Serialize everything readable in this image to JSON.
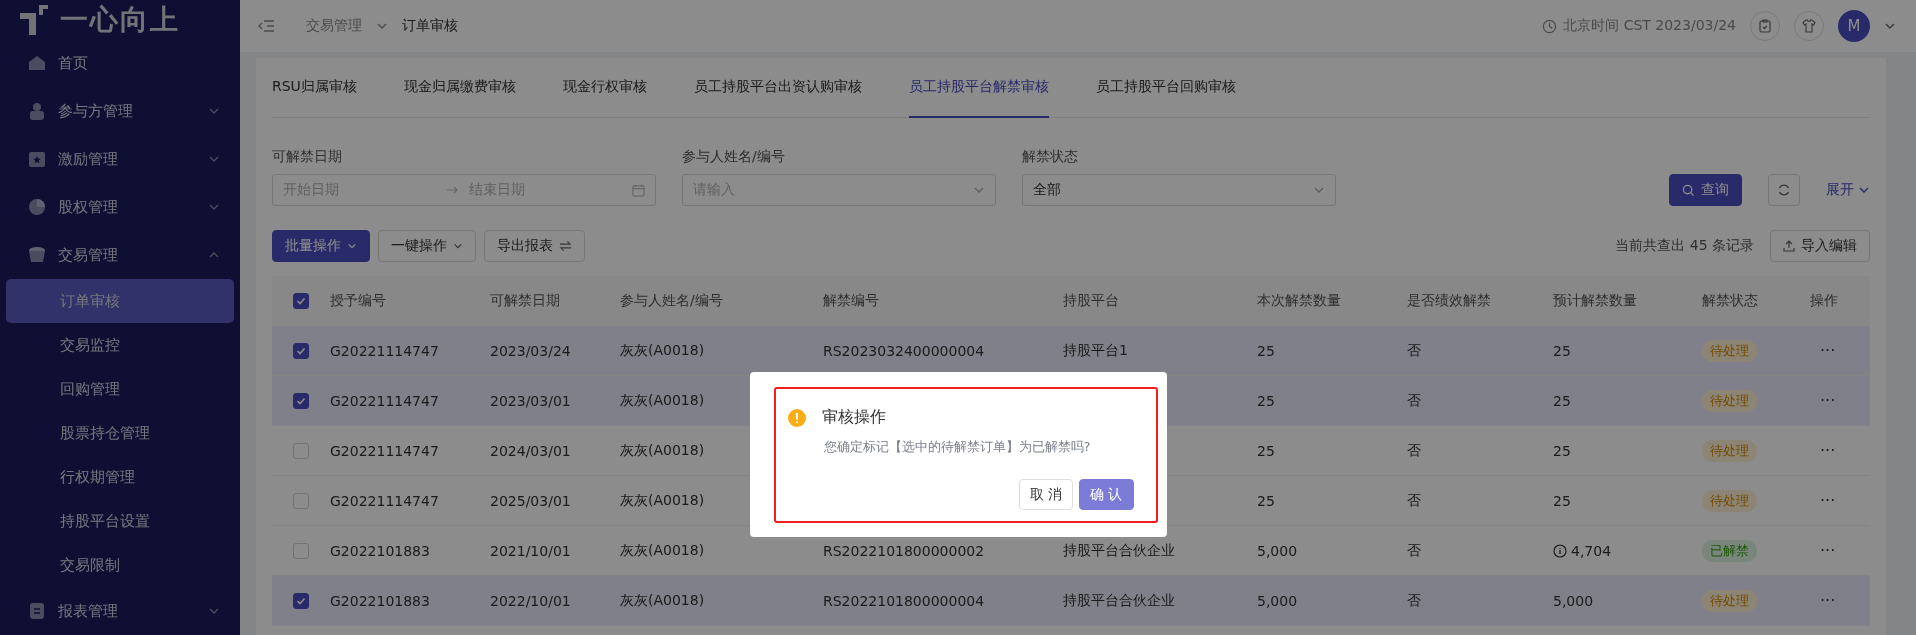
{
  "sidebar": {
    "logo": "一心向上",
    "items": [
      {
        "label": "首页",
        "kind": "link"
      },
      {
        "label": "参与方管理",
        "kind": "group",
        "expanded": false
      },
      {
        "label": "激励管理",
        "kind": "group",
        "expanded": false
      },
      {
        "label": "股权管理",
        "kind": "group",
        "expanded": false
      },
      {
        "label": "交易管理",
        "kind": "group",
        "expanded": true,
        "children": [
          {
            "label": "订单审核",
            "selected": true
          },
          {
            "label": "交易监控",
            "selected": false
          },
          {
            "label": "回购管理",
            "selected": false
          },
          {
            "label": "股票持仓管理",
            "selected": false
          },
          {
            "label": "行权期管理",
            "selected": false
          },
          {
            "label": "持股平台设置",
            "selected": false
          },
          {
            "label": "交易限制",
            "selected": false
          }
        ]
      },
      {
        "label": "报表管理",
        "kind": "group",
        "expanded": false
      }
    ]
  },
  "header": {
    "breadcrumb": [
      "交易管理",
      "订单审核"
    ],
    "time": "北京时间 CST 2023/03/24",
    "avatar": "M"
  },
  "tabs": [
    {
      "label": "RSU归属审核",
      "selected": false
    },
    {
      "label": "现金归属缴费审核",
      "selected": false
    },
    {
      "label": "现金行权审核",
      "selected": false
    },
    {
      "label": "员工持股平台出资认购审核",
      "selected": false
    },
    {
      "label": "员工持股平台解禁审核",
      "selected": true
    },
    {
      "label": "员工持股平台回购审核",
      "selected": false
    }
  ],
  "filters": [
    {
      "kind": "daterange",
      "label": "可解禁日期",
      "start_placeholder": "开始日期",
      "end_placeholder": "结束日期"
    },
    {
      "kind": "select",
      "label": "参与人姓名/编号",
      "placeholder": "请输入"
    },
    {
      "kind": "select",
      "label": "解禁状态",
      "value": "全部"
    }
  ],
  "filter_actions": {
    "search": "查询",
    "expand": "展开"
  },
  "toolbar": {
    "buttons": [
      {
        "label": "批量操作",
        "kind": "primary-dropdown"
      },
      {
        "label": "一键操作",
        "kind": "dropdown"
      },
      {
        "label": "导出报表",
        "kind": "export"
      }
    ],
    "record_count": "当前共查出 45 条记录",
    "import": "导入编辑"
  },
  "table": {
    "select_all": {
      "checked": true
    },
    "columns": [
      "授予编号",
      "可解禁日期",
      "参与人姓名/编号",
      "解禁编号",
      "持股平台",
      "本次解禁数量",
      "是否绩效解禁",
      "预计解禁数量",
      "解禁状态",
      "操作"
    ],
    "rows": [
      {
        "selected": true,
        "cells": [
          "G20221114747",
          "2023/03/24",
          "灰灰(A0018)",
          "RS2023032400000004",
          "持股平台1",
          "25",
          "否",
          "25"
        ],
        "info": false,
        "status": {
          "label": "待处理",
          "kind": "pending"
        },
        "action": "···"
      },
      {
        "selected": true,
        "cells": [
          "G20221114747",
          "2023/03/01",
          "灰灰(A0018)",
          "",
          "",
          "25",
          "否",
          "25"
        ],
        "info": false,
        "status": {
          "label": "待处理",
          "kind": "pending"
        },
        "action": "···"
      },
      {
        "selected": false,
        "cells": [
          "G20221114747",
          "2024/03/01",
          "灰灰(A0018)",
          "",
          "",
          "25",
          "否",
          "25"
        ],
        "info": false,
        "status": {
          "label": "待处理",
          "kind": "pending"
        },
        "action": "···"
      },
      {
        "selected": false,
        "cells": [
          "G20221114747",
          "2025/03/01",
          "灰灰(A0018)",
          "",
          "",
          "25",
          "否",
          "25"
        ],
        "info": false,
        "status": {
          "label": "待处理",
          "kind": "pending"
        },
        "action": "···"
      },
      {
        "selected": false,
        "cells": [
          "G2022101883",
          "2021/10/01",
          "灰灰(A0018)",
          "RS2022101800000002",
          "持股平台合伙企业",
          "5,000",
          "否",
          "4,704"
        ],
        "info": true,
        "status": {
          "label": "已解禁",
          "kind": "released"
        },
        "action": "···"
      },
      {
        "selected": true,
        "cells": [
          "G2022101883",
          "2022/10/01",
          "灰灰(A0018)",
          "RS2022101800000004",
          "持股平台合伙企业",
          "5,000",
          "否",
          "5,000"
        ],
        "info": false,
        "status": {
          "label": "待处理",
          "kind": "pending"
        },
        "action": "···"
      }
    ]
  },
  "dialog": {
    "title": "审核操作",
    "message": "您确定标记【选中的待解禁订单】为已解禁吗?",
    "highlighted": true,
    "cancel": "取 消",
    "confirm": "确 认"
  }
}
